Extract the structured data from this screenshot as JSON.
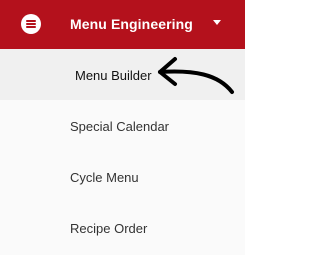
{
  "header": {
    "title": "Menu Engineering",
    "menu_icon": "hamburger-menu-icon",
    "dropdown_icon": "caret-down-icon",
    "background_color": "#b4111c"
  },
  "items": [
    {
      "label": "Menu Builder",
      "active": true
    },
    {
      "label": "Special Calendar",
      "active": false
    },
    {
      "label": "Cycle Menu",
      "active": false
    },
    {
      "label": "Recipe Order",
      "active": false
    }
  ],
  "annotation": {
    "icon": "hand-drawn-arrow-icon",
    "color": "#000000"
  }
}
